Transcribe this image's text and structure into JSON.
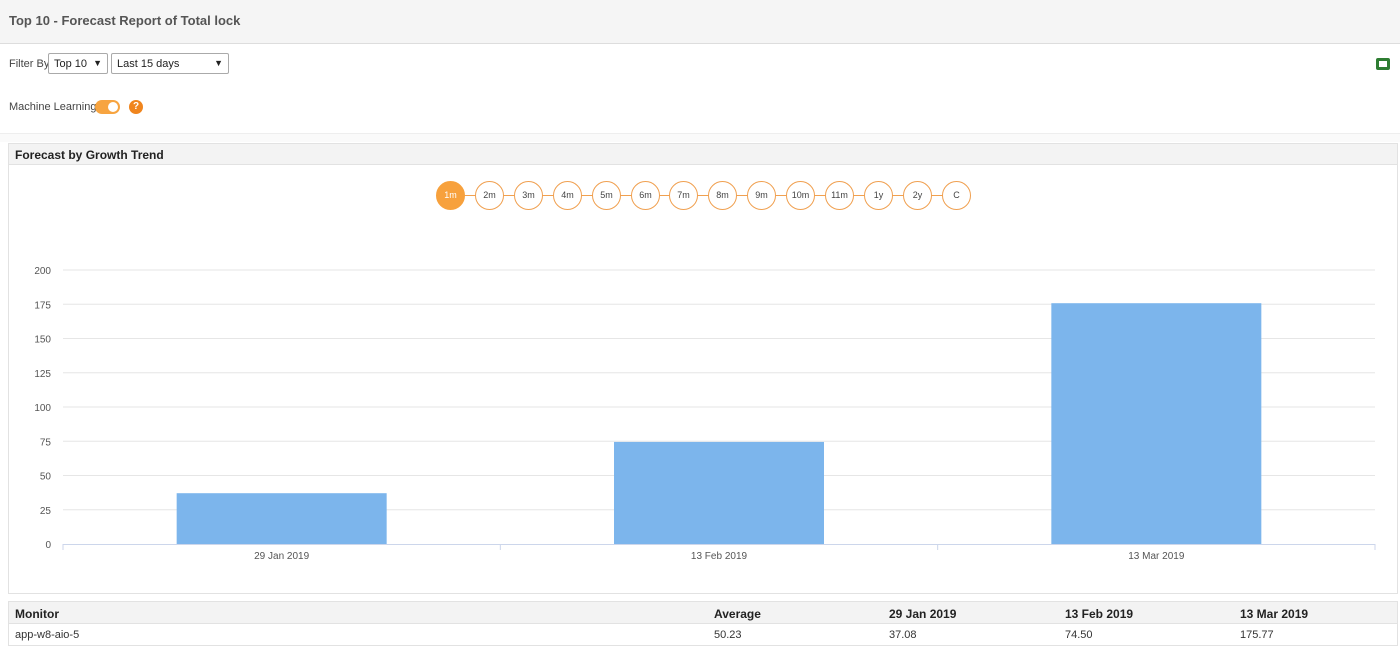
{
  "header": {
    "title": "Top 10 - Forecast Report of Total lock"
  },
  "filters": {
    "label": "Filter By",
    "top_select": "Top 10",
    "period_select": "Last 15 days"
  },
  "machine_learning": {
    "label": "Machine Learning",
    "enabled": true,
    "help": "?"
  },
  "panel": {
    "title": "Forecast by Growth Trend"
  },
  "range_buttons": [
    "1m",
    "2m",
    "3m",
    "4m",
    "5m",
    "6m",
    "7m",
    "8m",
    "9m",
    "10m",
    "11m",
    "1y",
    "2y",
    "C"
  ],
  "range_active": "1m",
  "colors": {
    "accent": "#f7a13d",
    "bar": "#7cb5ec"
  },
  "chart_data": {
    "type": "bar",
    "categories": [
      "29 Jan 2019",
      "13 Feb 2019",
      "13 Mar 2019"
    ],
    "values": [
      37.08,
      74.5,
      175.77
    ],
    "ylim": [
      0,
      200
    ],
    "yticks": [
      "0",
      "25",
      "50",
      "75",
      "100",
      "125",
      "150",
      "175",
      "200"
    ],
    "grid": true
  },
  "table": {
    "headers": [
      "Monitor",
      "Average",
      "29 Jan 2019",
      "13 Feb 2019",
      "13 Mar 2019"
    ],
    "rows": [
      [
        "app-w8-aio-5",
        "50.23",
        "37.08",
        "74.50",
        "175.77"
      ]
    ]
  },
  "icons": {
    "export": "excel-export-icon"
  }
}
